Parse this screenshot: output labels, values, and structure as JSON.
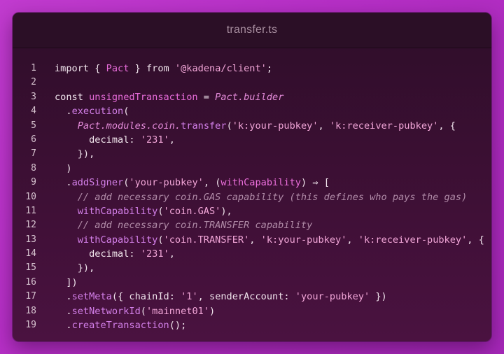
{
  "window": {
    "title": "transfer.ts"
  },
  "colors": {
    "background": "#b934c9",
    "window": "#3b0f33",
    "titlebar": "#2b0f26",
    "string": "#f2a6d8",
    "identifier": "#ec6fdc",
    "function": "#d480ea",
    "comment": "#b18ca8"
  },
  "editor": {
    "language": "TypeScript",
    "lines": [
      {
        "n": "1",
        "tokens": [
          {
            "t": "import { ",
            "c": "kw"
          },
          {
            "t": "Pact",
            "c": "var"
          },
          {
            "t": " } from ",
            "c": "kw"
          },
          {
            "t": "'@kadena/client'",
            "c": "str"
          },
          {
            "t": ";",
            "c": "punc"
          }
        ]
      },
      {
        "n": "2",
        "tokens": []
      },
      {
        "n": "3",
        "tokens": [
          {
            "t": "const ",
            "c": "kw"
          },
          {
            "t": "unsignedTransaction",
            "c": "var"
          },
          {
            "t": " = ",
            "c": "punc"
          },
          {
            "t": "Pact.builder",
            "c": "cls"
          }
        ]
      },
      {
        "n": "4",
        "tokens": [
          {
            "t": "  .",
            "c": "punc"
          },
          {
            "t": "execution",
            "c": "fn"
          },
          {
            "t": "(",
            "c": "punc"
          }
        ]
      },
      {
        "n": "5",
        "tokens": [
          {
            "t": "    ",
            "c": "punc"
          },
          {
            "t": "Pact.modules.coin.",
            "c": "cls"
          },
          {
            "t": "transfer",
            "c": "fn"
          },
          {
            "t": "(",
            "c": "punc"
          },
          {
            "t": "'k:your-pubkey'",
            "c": "str"
          },
          {
            "t": ", ",
            "c": "punc"
          },
          {
            "t": "'k:receiver-pubkey'",
            "c": "str"
          },
          {
            "t": ", {",
            "c": "punc"
          }
        ]
      },
      {
        "n": "6",
        "tokens": [
          {
            "t": "      decimal: ",
            "c": "prop"
          },
          {
            "t": "'231'",
            "c": "str"
          },
          {
            "t": ",",
            "c": "punc"
          }
        ]
      },
      {
        "n": "7",
        "tokens": [
          {
            "t": "    }),",
            "c": "punc"
          }
        ]
      },
      {
        "n": "8",
        "tokens": [
          {
            "t": "  )",
            "c": "punc"
          }
        ]
      },
      {
        "n": "9",
        "tokens": [
          {
            "t": "  .",
            "c": "punc"
          },
          {
            "t": "addSigner",
            "c": "fn"
          },
          {
            "t": "(",
            "c": "punc"
          },
          {
            "t": "'your-pubkey'",
            "c": "str"
          },
          {
            "t": ", (",
            "c": "punc"
          },
          {
            "t": "withCapability",
            "c": "ident"
          },
          {
            "t": ") ⇒ [",
            "c": "punc"
          }
        ]
      },
      {
        "n": "10",
        "tokens": [
          {
            "t": "    // add necessary coin.GAS capability (this defines who pays the gas)",
            "c": "cmt"
          }
        ]
      },
      {
        "n": "11",
        "tokens": [
          {
            "t": "    ",
            "c": "punc"
          },
          {
            "t": "withCapability",
            "c": "fn"
          },
          {
            "t": "(",
            "c": "punc"
          },
          {
            "t": "'coin.GAS'",
            "c": "str"
          },
          {
            "t": "),",
            "c": "punc"
          }
        ]
      },
      {
        "n": "12",
        "tokens": [
          {
            "t": "    // add necessary coin.TRANSFER capability",
            "c": "cmt"
          }
        ]
      },
      {
        "n": "13",
        "tokens": [
          {
            "t": "    ",
            "c": "punc"
          },
          {
            "t": "withCapability",
            "c": "fn"
          },
          {
            "t": "(",
            "c": "punc"
          },
          {
            "t": "'coin.TRANSFER'",
            "c": "str"
          },
          {
            "t": ", ",
            "c": "punc"
          },
          {
            "t": "'k:your-pubkey'",
            "c": "str"
          },
          {
            "t": ", ",
            "c": "punc"
          },
          {
            "t": "'k:receiver-pubkey'",
            "c": "str"
          },
          {
            "t": ", {",
            "c": "punc"
          }
        ]
      },
      {
        "n": "14",
        "tokens": [
          {
            "t": "      decimal: ",
            "c": "prop"
          },
          {
            "t": "'231'",
            "c": "str"
          },
          {
            "t": ",",
            "c": "punc"
          }
        ]
      },
      {
        "n": "15",
        "tokens": [
          {
            "t": "    }),",
            "c": "punc"
          }
        ]
      },
      {
        "n": "16",
        "tokens": [
          {
            "t": "  ])",
            "c": "punc"
          }
        ]
      },
      {
        "n": "17",
        "tokens": [
          {
            "t": "  .",
            "c": "punc"
          },
          {
            "t": "setMeta",
            "c": "fn"
          },
          {
            "t": "({ chainId: ",
            "c": "punc"
          },
          {
            "t": "'1'",
            "c": "str"
          },
          {
            "t": ", senderAccount: ",
            "c": "punc"
          },
          {
            "t": "'your-pubkey'",
            "c": "str"
          },
          {
            "t": " })",
            "c": "punc"
          }
        ]
      },
      {
        "n": "18",
        "tokens": [
          {
            "t": "  .",
            "c": "punc"
          },
          {
            "t": "setNetworkId",
            "c": "fn"
          },
          {
            "t": "(",
            "c": "punc"
          },
          {
            "t": "'mainnet01'",
            "c": "str"
          },
          {
            "t": ")",
            "c": "punc"
          }
        ]
      },
      {
        "n": "19",
        "tokens": [
          {
            "t": "  .",
            "c": "punc"
          },
          {
            "t": "createTransaction",
            "c": "fn"
          },
          {
            "t": "();",
            "c": "punc"
          }
        ]
      }
    ]
  }
}
